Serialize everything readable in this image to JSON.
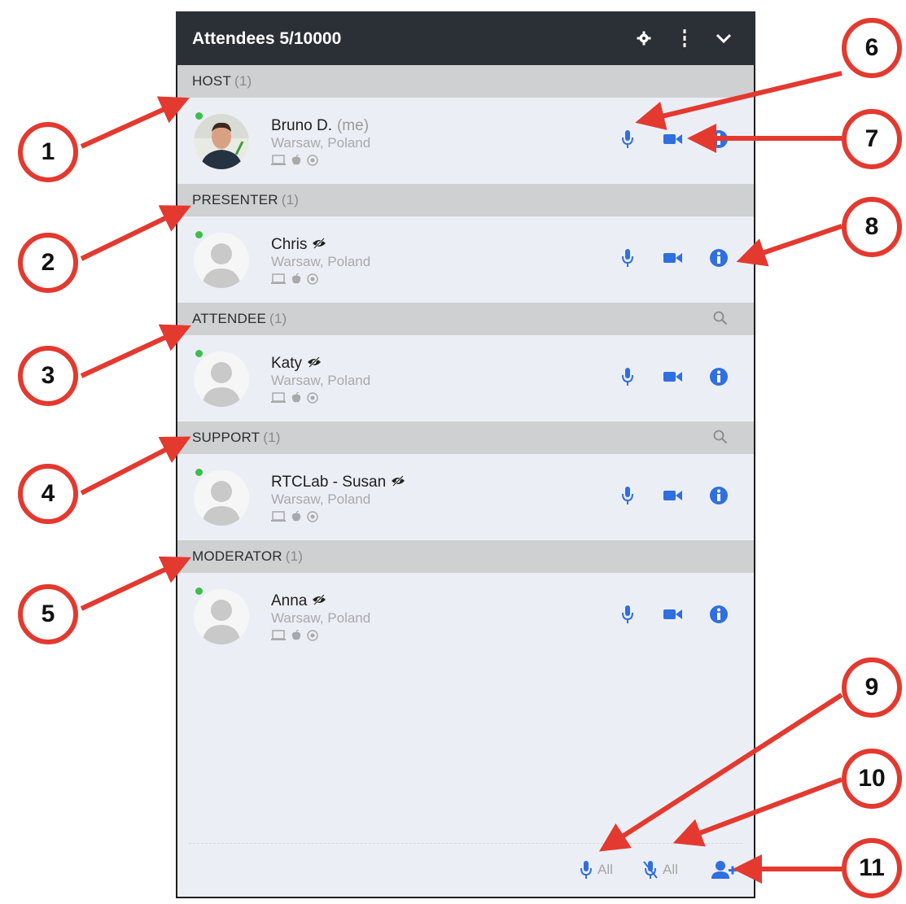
{
  "header": {
    "title": "Attendees 5/10000",
    "icons": [
      "gear-icon",
      "vertical-dots-icon",
      "chevron-down-icon"
    ]
  },
  "sections": [
    {
      "id": "host",
      "label": "HOST",
      "count": "(1)",
      "searchable": false,
      "attendee": {
        "name": "Bruno D.",
        "suffix": "(me)",
        "location": "Warsaw, Poland",
        "photo": true,
        "hidden_icon": false
      }
    },
    {
      "id": "presenter",
      "label": "PRESENTER",
      "count": "(1)",
      "searchable": false,
      "attendee": {
        "name": "Chris",
        "suffix": "",
        "location": "Warsaw, Poland",
        "photo": false,
        "hidden_icon": true
      }
    },
    {
      "id": "attendee",
      "label": "ATTENDEE",
      "count": "(1)",
      "searchable": true,
      "attendee": {
        "name": "Katy",
        "suffix": "",
        "location": "Warsaw, Poland",
        "photo": false,
        "hidden_icon": true
      }
    },
    {
      "id": "support",
      "label": "SUPPORT",
      "count": "(1)",
      "searchable": true,
      "attendee": {
        "name": "RTCLab - Susan",
        "suffix": "",
        "location": "Warsaw, Poland",
        "photo": false,
        "hidden_icon": true
      }
    },
    {
      "id": "moderator",
      "label": "MODERATOR",
      "count": "(1)",
      "searchable": false,
      "attendee": {
        "name": "Anna",
        "suffix": "",
        "location": "Warsaw, Poland",
        "photo": false,
        "hidden_icon": true
      }
    }
  ],
  "footer": {
    "unmute_all_label": "All",
    "mute_all_label": "All"
  },
  "callouts": [
    "1",
    "2",
    "3",
    "4",
    "5",
    "6",
    "7",
    "8",
    "9",
    "10",
    "11"
  ],
  "colors": {
    "accent": "#2f6fe0",
    "header_bg": "#2b2f36",
    "callout": "#e4392f",
    "online": "#3bbf4a"
  }
}
